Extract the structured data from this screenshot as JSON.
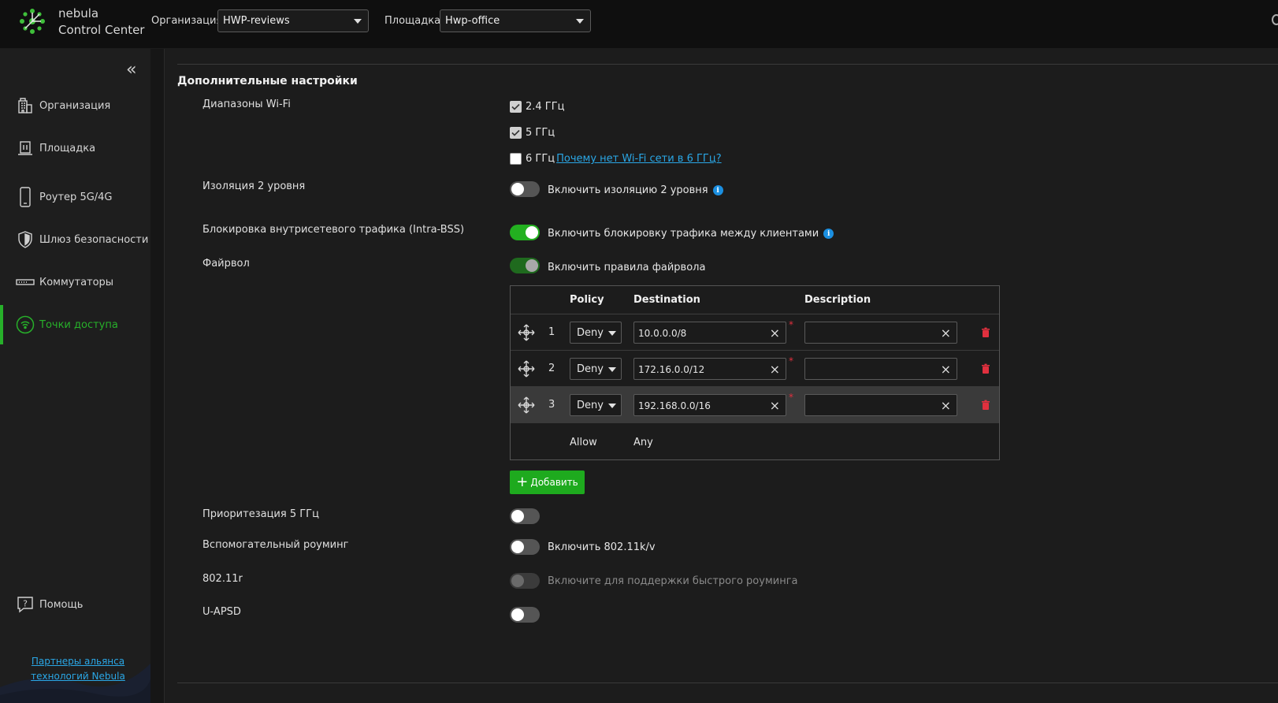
{
  "header": {
    "brand_line1": "nebula",
    "brand_line2": "Control Center",
    "org_label": "Организация:",
    "org_value": "HWP-reviews",
    "site_label": "Площадка:",
    "site_value": "Hwp-office"
  },
  "sidebar": {
    "items": [
      {
        "label": "Организация",
        "icon": "building-icon"
      },
      {
        "label": "Площадка",
        "icon": "site-icon"
      },
      {
        "label": "Роутер 5G/4G",
        "icon": "mobile-router-icon"
      },
      {
        "label": "Шлюз безопасности",
        "icon": "shield-icon"
      },
      {
        "label": "Коммутаторы",
        "icon": "switch-icon"
      },
      {
        "label": "Точки доступа",
        "icon": "wifi-ap-icon",
        "active": true
      }
    ],
    "help": "Помощь",
    "partner_line1": "Партнеры альянса",
    "partner_line2": "технологий Nebula"
  },
  "settings": {
    "title": "Дополнительные настройки",
    "wifi_bands": {
      "label": "Диапазоны Wi-Fi",
      "b24": "2.4 ГГц",
      "b5": "5 ГГц",
      "b6": "6 ГГц",
      "b6_link": "Почему нет Wi-Fi сети в 6 ГГц?"
    },
    "l2_isolation": {
      "label": "Изоляция 2 уровня",
      "toggle_text": "Включить изоляцию 2 уровня",
      "state": "off"
    },
    "intra_bss": {
      "label": "Блокировка внутрисетевого трафика (Intra-BSS)",
      "toggle_text": "Включить блокировку трафика между клиентами",
      "state": "on"
    },
    "firewall": {
      "label": "Файрвол",
      "toggle_text": "Включить правила файрвола",
      "state": "on",
      "columns": {
        "policy": "Policy",
        "destination": "Destination",
        "description": "Description"
      },
      "rules": [
        {
          "index": "1",
          "policy": "Deny",
          "destination": "10.0.0.0/8",
          "description": ""
        },
        {
          "index": "2",
          "policy": "Deny",
          "destination": "172.16.0.0/12",
          "description": ""
        },
        {
          "index": "3",
          "policy": "Deny",
          "destination": "192.168.0.0/16",
          "description": ""
        }
      ],
      "default_policy": "Allow",
      "default_destination": "Any",
      "add_label": "Добавить"
    },
    "band_steering": {
      "label": "Приоритезация 5 ГГц",
      "state": "off"
    },
    "assisted_roaming": {
      "label": "Вспомогательный роуминг",
      "toggle_text": "Включить 802.11k/v",
      "state": "off"
    },
    "fast_roaming": {
      "label": "802.11r",
      "toggle_text": "Включите для поддержки быстрого роуминга",
      "state": "disabled"
    },
    "uapsd": {
      "label": "U-APSD",
      "state": "off"
    }
  },
  "colors": {
    "accent": "#23b020",
    "link": "#2aa7e6",
    "danger": "#e0303e",
    "info": "#1b8fe0"
  }
}
